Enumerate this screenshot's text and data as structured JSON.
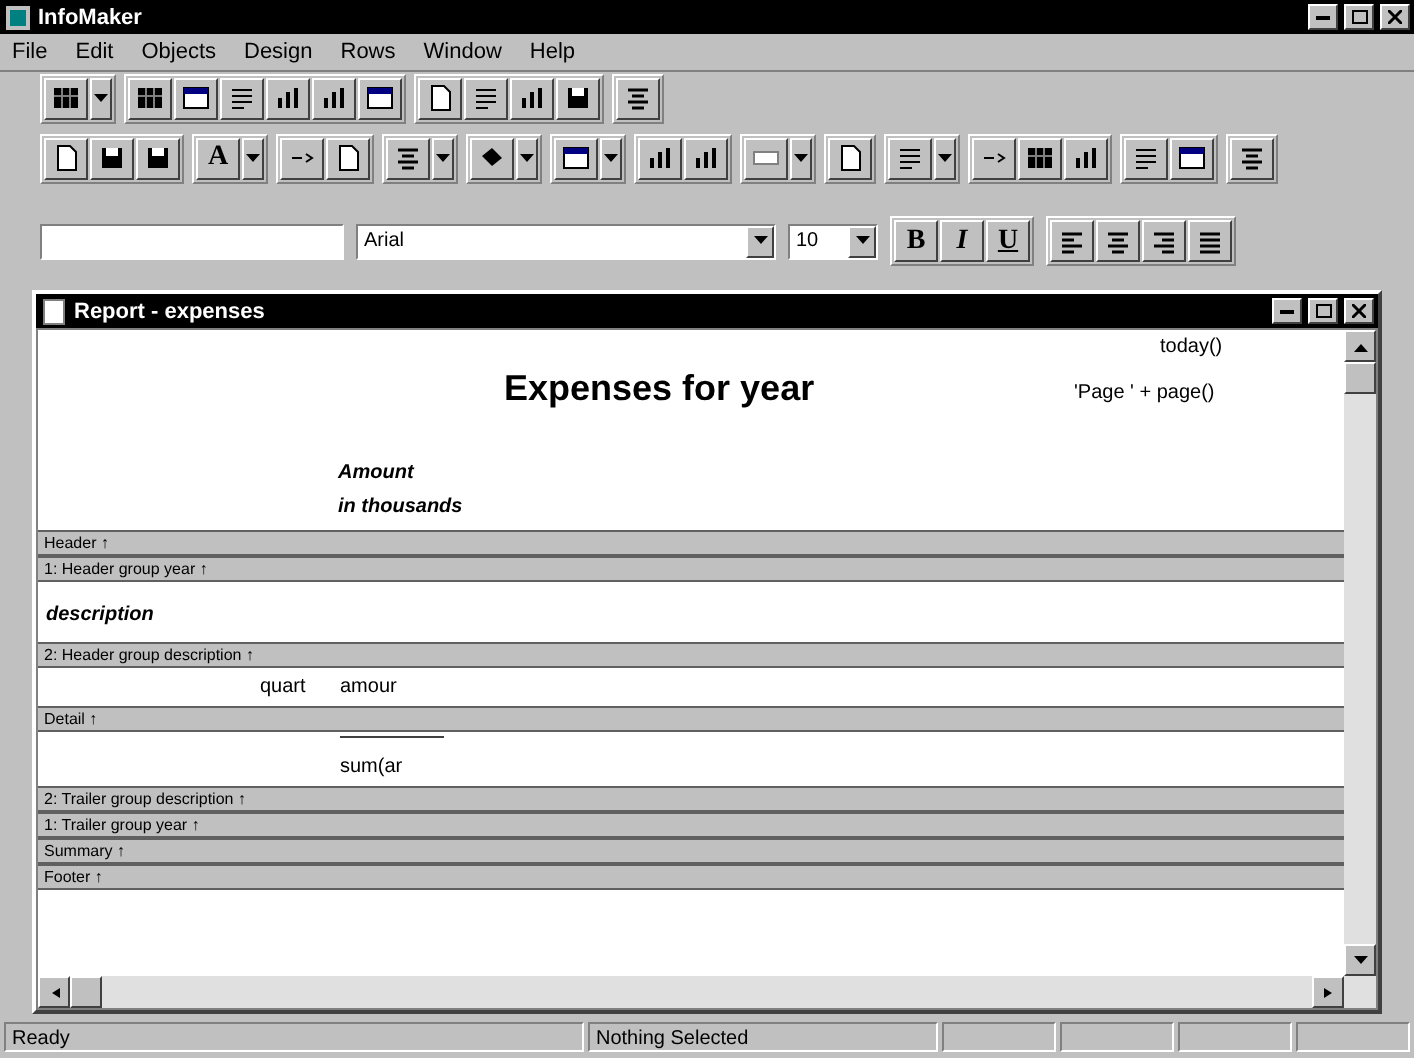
{
  "window": {
    "title": "InfoMaker"
  },
  "menu": [
    "File",
    "Edit",
    "Objects",
    "Design",
    "Rows",
    "Window",
    "Help"
  ],
  "style_bar": {
    "font": "Arial",
    "size": "10",
    "format_buttons": [
      "B",
      "I",
      "U"
    ]
  },
  "text_button": "A",
  "report_window": {
    "title": "Report - expenses",
    "sections": [
      {
        "band": "Header ↑",
        "items": [
          {
            "kind": "title",
            "text": "Expenses for  year"
          },
          {
            "kind": "computed",
            "text": "today()"
          },
          {
            "kind": "computed",
            "text": "'Page ' + page()"
          },
          {
            "kind": "label",
            "text": "Amount"
          },
          {
            "kind": "label",
            "text": "in thousands"
          }
        ]
      },
      {
        "band": "1: Header group year ↑"
      },
      {
        "band": "2: Header group description ↑",
        "items": [
          {
            "kind": "label",
            "text": "description"
          }
        ]
      },
      {
        "band": "Detail ↑",
        "items": [
          {
            "kind": "column",
            "text": "quart"
          },
          {
            "kind": "column",
            "text": "amour"
          }
        ]
      },
      {
        "band": "2: Trailer group description ↑",
        "items": [
          {
            "kind": "line"
          },
          {
            "kind": "column",
            "text": "sum(ar"
          }
        ]
      },
      {
        "band": "1: Trailer group year ↑"
      },
      {
        "band": "Summary ↑"
      },
      {
        "band": "Footer ↑"
      }
    ]
  },
  "status_bar": [
    "Ready",
    "Nothing Selected"
  ]
}
